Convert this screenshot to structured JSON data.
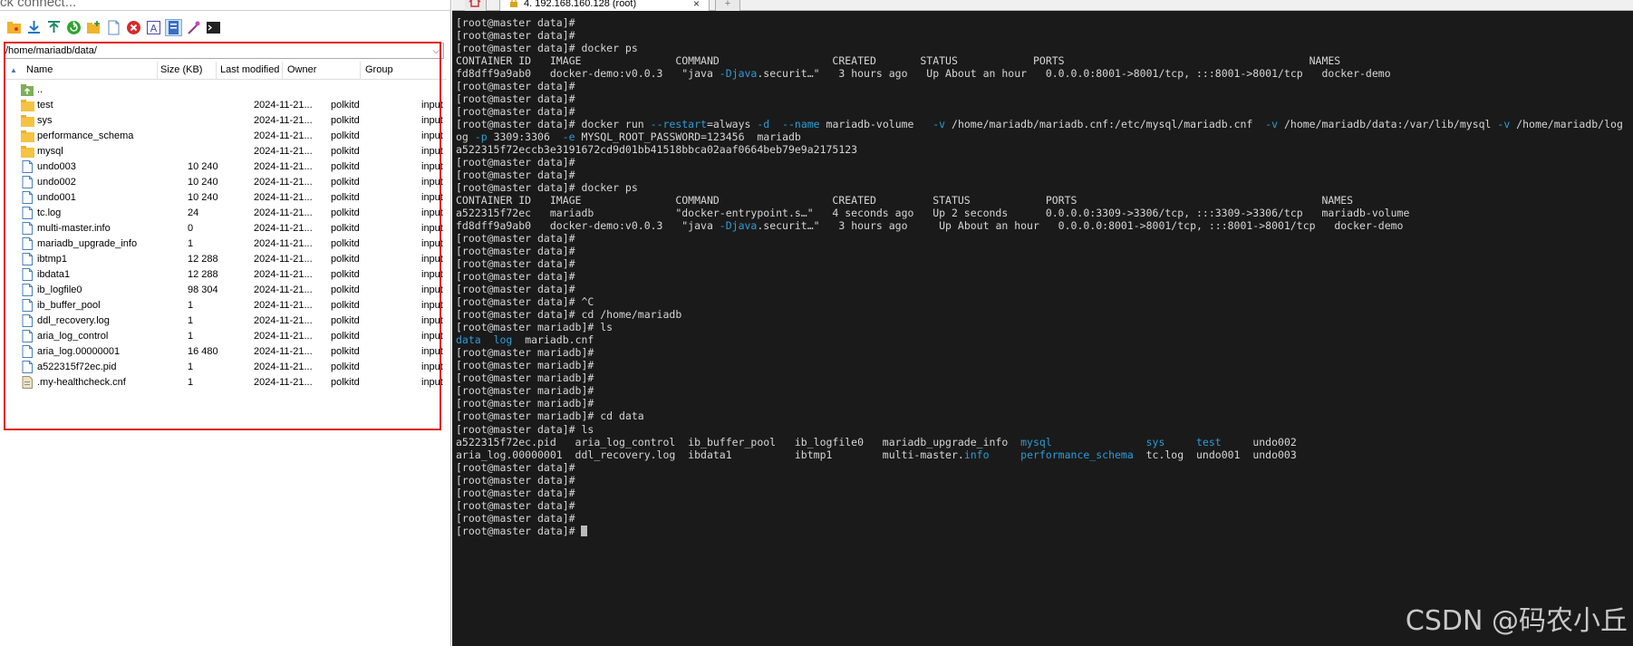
{
  "quick_connect": "ck connect...",
  "toolbar": [
    "open-folder-icon",
    "download-icon",
    "upload-icon",
    "refresh-icon",
    "new-folder-icon",
    "new-file-icon",
    "delete-icon",
    "rename-icon",
    "properties-icon",
    "chmod-icon",
    "terminal-icon"
  ],
  "path": "/home/mariadb/data/",
  "columns": {
    "name": "Name",
    "size": "Size (KB)",
    "modified": "Last modified",
    "owner": "Owner",
    "group": "Group"
  },
  "files": [
    {
      "name": "..",
      "type": "up",
      "size": "",
      "modified": "",
      "owner": "",
      "group": ""
    },
    {
      "name": "test",
      "type": "folder",
      "size": "",
      "modified": "2024-11-21...",
      "owner": "polkitd",
      "group": "input"
    },
    {
      "name": "sys",
      "type": "folder",
      "size": "",
      "modified": "2024-11-21...",
      "owner": "polkitd",
      "group": "input"
    },
    {
      "name": "performance_schema",
      "type": "folder",
      "size": "",
      "modified": "2024-11-21...",
      "owner": "polkitd",
      "group": "input"
    },
    {
      "name": "mysql",
      "type": "folder",
      "size": "",
      "modified": "2024-11-21...",
      "owner": "polkitd",
      "group": "input"
    },
    {
      "name": "undo003",
      "type": "file",
      "size": "10 240",
      "modified": "2024-11-21...",
      "owner": "polkitd",
      "group": "input"
    },
    {
      "name": "undo002",
      "type": "file",
      "size": "10 240",
      "modified": "2024-11-21...",
      "owner": "polkitd",
      "group": "input"
    },
    {
      "name": "undo001",
      "type": "file",
      "size": "10 240",
      "modified": "2024-11-21...",
      "owner": "polkitd",
      "group": "input"
    },
    {
      "name": "tc.log",
      "type": "file",
      "size": "24",
      "modified": "2024-11-21...",
      "owner": "polkitd",
      "group": "input"
    },
    {
      "name": "multi-master.info",
      "type": "file",
      "size": "0",
      "modified": "2024-11-21...",
      "owner": "polkitd",
      "group": "input"
    },
    {
      "name": "mariadb_upgrade_info",
      "type": "file",
      "size": "1",
      "modified": "2024-11-21...",
      "owner": "polkitd",
      "group": "input"
    },
    {
      "name": "ibtmp1",
      "type": "file",
      "size": "12 288",
      "modified": "2024-11-21...",
      "owner": "polkitd",
      "group": "input"
    },
    {
      "name": "ibdata1",
      "type": "file",
      "size": "12 288",
      "modified": "2024-11-21...",
      "owner": "polkitd",
      "group": "input"
    },
    {
      "name": "ib_logfile0",
      "type": "file",
      "size": "98 304",
      "modified": "2024-11-21...",
      "owner": "polkitd",
      "group": "input"
    },
    {
      "name": "ib_buffer_pool",
      "type": "file",
      "size": "1",
      "modified": "2024-11-21...",
      "owner": "polkitd",
      "group": "input"
    },
    {
      "name": "ddl_recovery.log",
      "type": "file",
      "size": "1",
      "modified": "2024-11-21...",
      "owner": "polkitd",
      "group": "input"
    },
    {
      "name": "aria_log_control",
      "type": "file",
      "size": "1",
      "modified": "2024-11-21...",
      "owner": "polkitd",
      "group": "input"
    },
    {
      "name": "aria_log.00000001",
      "type": "file",
      "size": "16 480",
      "modified": "2024-11-21...",
      "owner": "polkitd",
      "group": "input"
    },
    {
      "name": "a522315f72ec.pid",
      "type": "file",
      "size": "1",
      "modified": "2024-11-21...",
      "owner": "polkitd",
      "group": "input"
    },
    {
      "name": ".my-healthcheck.cnf",
      "type": "cnf",
      "size": "1",
      "modified": "2024-11-21...",
      "owner": "polkitd",
      "group": "input"
    }
  ],
  "tabs": {
    "active_label": "4. 192.168.160.128 (root)",
    "close": "×",
    "new": "+"
  },
  "terminal_lines": [
    [
      [
        "[root@master data]#",
        ""
      ]
    ],
    [
      [
        "[root@master data]#",
        ""
      ]
    ],
    [
      [
        "[root@master data]# docker ps",
        ""
      ]
    ],
    [
      [
        "CONTAINER ID   IMAGE               COMMAND                  CREATED       STATUS            PORTS                                       NAMES",
        ""
      ]
    ],
    [
      [
        "fd8dff9a9ab0   docker-demo:v0.0.3   \"java ",
        ""
      ],
      [
        "-Djava",
        "b"
      ],
      [
        ".securit…\"   3 hours ago   Up About an hour   0.0.0.0:8001->8001/tcp, :::8001->8001/tcp   docker-demo",
        ""
      ]
    ],
    [
      [
        "[root@master data]#",
        ""
      ]
    ],
    [
      [
        "[root@master data]#",
        ""
      ]
    ],
    [
      [
        "[root@master data]#",
        ""
      ]
    ],
    [
      [
        "[root@master data]# docker run ",
        ""
      ],
      [
        "--restart",
        "b"
      ],
      [
        "=always ",
        ""
      ],
      [
        "-d",
        "b"
      ],
      [
        "  ",
        ""
      ],
      [
        "--name",
        "b"
      ],
      [
        " mariadb-volume   ",
        ""
      ],
      [
        "-v",
        "b"
      ],
      [
        " /home/mariadb/mariadb.cnf:/etc/mysql/mariadb.cnf  ",
        ""
      ],
      [
        "-v",
        "b"
      ],
      [
        " /home/mariadb/data:/var/lib/mysql ",
        ""
      ],
      [
        "-v",
        "b"
      ],
      [
        " /home/mariadb/log",
        ""
      ]
    ],
    [
      [
        "og ",
        ""
      ],
      [
        "-p",
        "b"
      ],
      [
        " 3309:3306  ",
        ""
      ],
      [
        "-e",
        "b"
      ],
      [
        " MYSQL_ROOT_PASSWORD=123456  mariadb",
        ""
      ]
    ],
    [
      [
        "a522315f72eccb3e3191672cd9d01bb41518bbca02aaf0664beb79e9a2175123",
        ""
      ]
    ],
    [
      [
        "[root@master data]#",
        ""
      ]
    ],
    [
      [
        "[root@master data]#",
        ""
      ]
    ],
    [
      [
        "[root@master data]# docker ps",
        ""
      ]
    ],
    [
      [
        "CONTAINER ID   IMAGE               COMMAND                  CREATED         STATUS            PORTS                                       NAMES",
        ""
      ]
    ],
    [
      [
        "a522315f72ec   mariadb             \"docker-entrypoint.s…\"   4 seconds ago   Up 2 seconds      0.0.0.0:3309->3306/tcp, :::3309->3306/tcp   mariadb-volume",
        ""
      ]
    ],
    [
      [
        "fd8dff9a9ab0   docker-demo:v0.0.3   \"java ",
        ""
      ],
      [
        "-Djava",
        "b"
      ],
      [
        ".securit…\"   3 hours ago     Up About an hour   0.0.0.0:8001->8001/tcp, :::8001->8001/tcp   docker-demo",
        ""
      ]
    ],
    [
      [
        "[root@master data]#",
        ""
      ]
    ],
    [
      [
        "[root@master data]#",
        ""
      ]
    ],
    [
      [
        "[root@master data]#",
        ""
      ]
    ],
    [
      [
        "[root@master data]#",
        ""
      ]
    ],
    [
      [
        "[root@master data]#",
        ""
      ]
    ],
    [
      [
        "[root@master data]# ^C",
        ""
      ]
    ],
    [
      [
        "[root@master data]# cd /home/mariadb",
        ""
      ]
    ],
    [
      [
        "[root@master mariadb]# ls",
        ""
      ]
    ],
    [
      [
        "data",
        "b"
      ],
      [
        "  ",
        ""
      ],
      [
        "log",
        "b"
      ],
      [
        "  mariadb.cnf",
        ""
      ]
    ],
    [
      [
        "[root@master mariadb]#",
        ""
      ]
    ],
    [
      [
        "[root@master mariadb]#",
        ""
      ]
    ],
    [
      [
        "[root@master mariadb]#",
        ""
      ]
    ],
    [
      [
        "[root@master mariadb]#",
        ""
      ]
    ],
    [
      [
        "[root@master mariadb]#",
        ""
      ]
    ],
    [
      [
        "[root@master mariadb]# cd data",
        ""
      ]
    ],
    [
      [
        "[root@master data]# ls",
        ""
      ]
    ],
    [
      [
        "a522315f72ec.pid   aria_log_control  ib_buffer_pool   ib_logfile0   mariadb_upgrade_info  ",
        ""
      ],
      [
        "mysql",
        "b"
      ],
      [
        "               ",
        ""
      ],
      [
        "sys",
        "b"
      ],
      [
        "     ",
        ""
      ],
      [
        "test",
        "b"
      ],
      [
        "     undo002",
        ""
      ]
    ],
    [
      [
        "aria_log.00000001  ddl_recovery.log  ibdata1          ibtmp1        multi-master.",
        ""
      ],
      [
        "info",
        "b"
      ],
      [
        "     ",
        ""
      ],
      [
        "performance_schema",
        "b"
      ],
      [
        "  tc.log  undo001  undo003",
        ""
      ]
    ],
    [
      [
        "[root@master data]#",
        ""
      ]
    ],
    [
      [
        "[root@master data]#",
        ""
      ]
    ],
    [
      [
        "[root@master data]#",
        ""
      ]
    ],
    [
      [
        "[root@master data]#",
        ""
      ]
    ],
    [
      [
        "[root@master data]#",
        ""
      ]
    ],
    [
      [
        "[root@master data]# ",
        "",
        "cursor"
      ]
    ]
  ],
  "watermark": "CSDN @码农小丘",
  "colors": {
    "terminal_bg": "#1a1a1a",
    "terminal_fg": "#d6d6d6",
    "terminal_accent": "#2d9cd6",
    "highlight": "#e01a1a",
    "folder": "#f5c242"
  }
}
